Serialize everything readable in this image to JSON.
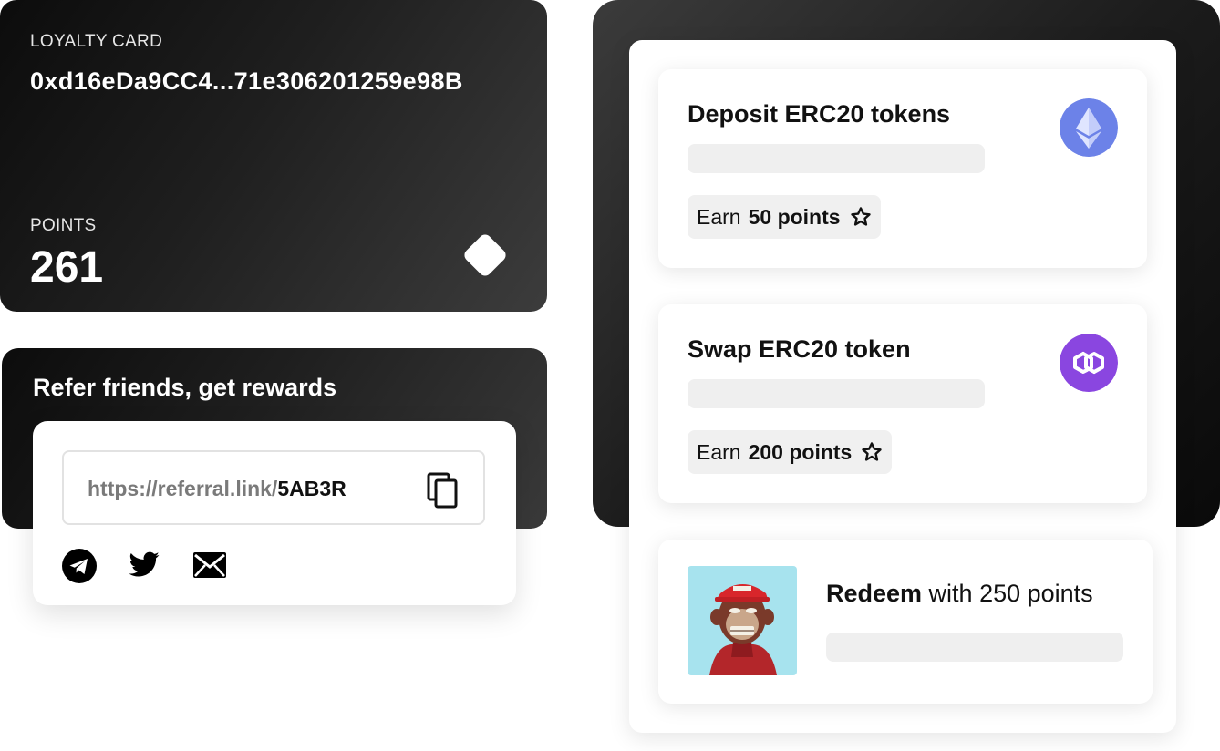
{
  "loyalty_card": {
    "label": "LOYALTY CARD",
    "address": "0xd16eDa9CC4...71e306201259e98B",
    "points_label": "POINTS",
    "points_value": "261"
  },
  "referral": {
    "title": "Refer friends, get rewards",
    "link_prefix": "https://referral.link/",
    "link_code": "5AB3R",
    "share_icons": [
      "telegram-icon",
      "twitter-icon",
      "email-icon"
    ]
  },
  "tasks": [
    {
      "title": "Deposit ERC20 tokens",
      "earn_prefix": "Earn",
      "earn_points": "50 points",
      "icon": "ethereum-icon"
    },
    {
      "title": "Swap ERC20 token",
      "earn_prefix": "Earn",
      "earn_points": "200 points",
      "icon": "polygon-icon"
    }
  ],
  "redeem": {
    "action": "Redeem",
    "rest": " with 250 points",
    "image": "ape-nft-image"
  },
  "colors": {
    "ethereum": "#6c82e8",
    "polygon": "#8a46e0",
    "card_dark": "#111111"
  }
}
